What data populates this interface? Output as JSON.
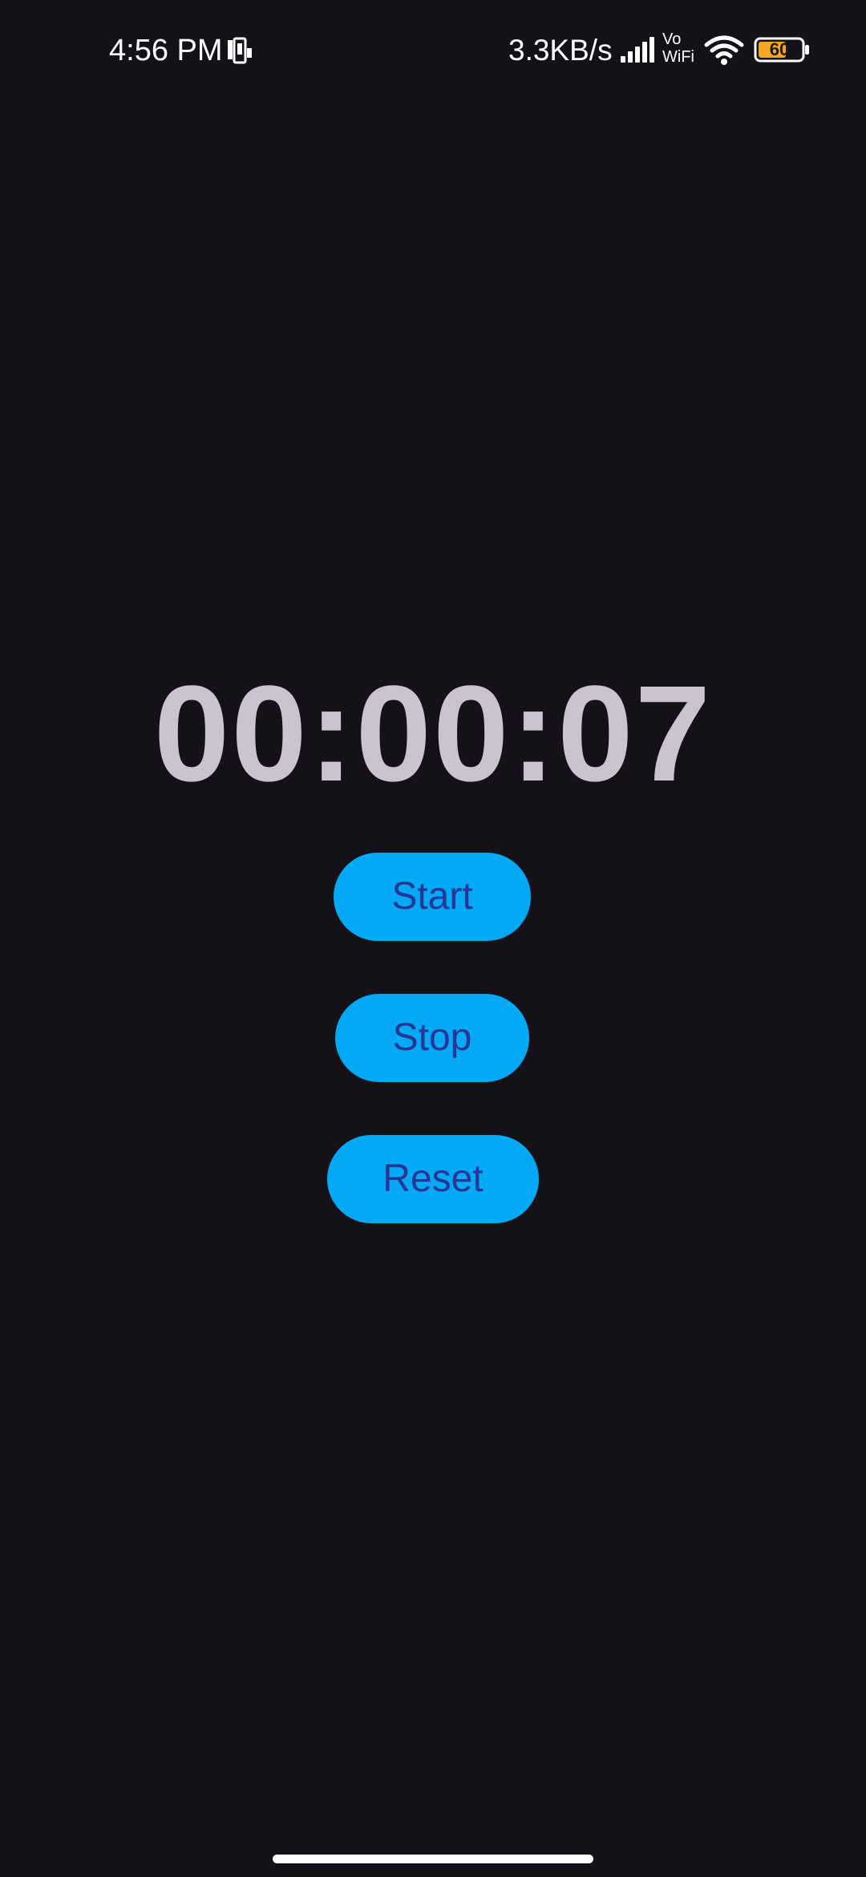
{
  "status_bar": {
    "time": "4:56 PM",
    "network_speed": "3.3KB/s",
    "vowifi_top": "Vo",
    "vowifi_bottom": "WiFi",
    "battery_level": "60",
    "icons": [
      "phone-screen-icon",
      "signal-icon",
      "vowifi-icon",
      "wifi-icon",
      "battery-icon"
    ]
  },
  "stopwatch": {
    "time_display": "00:00:07"
  },
  "controls": {
    "start_label": "Start",
    "stop_label": "Stop",
    "reset_label": "Reset"
  },
  "colors": {
    "background": "#141218",
    "timer_text": "#cac4d0",
    "button_bg": "#03a9f4",
    "button_text": "#283593",
    "battery_fill": "#f5a623"
  }
}
